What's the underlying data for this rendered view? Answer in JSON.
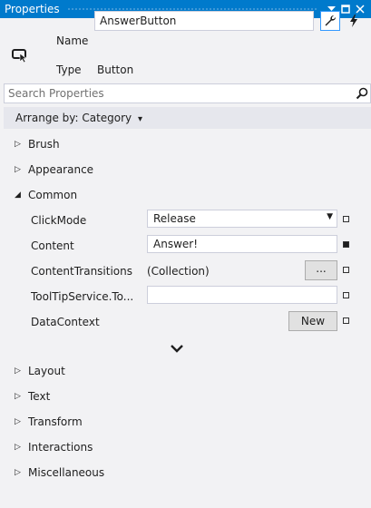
{
  "window": {
    "title": "Properties"
  },
  "header": {
    "name_label": "Name",
    "name_value": "AnswerButton",
    "type_label": "Type",
    "type_value": "Button"
  },
  "search": {
    "placeholder": "Search Properties"
  },
  "arrange": {
    "label": "Arrange by: Category",
    "arrow": "▾"
  },
  "categories_top": [
    {
      "label": "Brush",
      "expanded": false
    },
    {
      "label": "Appearance",
      "expanded": false
    },
    {
      "label": "Common",
      "expanded": true
    }
  ],
  "common": {
    "clickmode": {
      "label": "ClickMode",
      "value": "Release"
    },
    "content": {
      "label": "Content",
      "value": "Answer!"
    },
    "transitions": {
      "label": "ContentTransitions",
      "value": "(Collection)",
      "button": "..."
    },
    "tooltip": {
      "label": "ToolTipService.To...",
      "value": ""
    },
    "datacontext": {
      "label": "DataContext",
      "button": "New"
    }
  },
  "categories_bottom": [
    {
      "label": "Layout"
    },
    {
      "label": "Text"
    },
    {
      "label": "Transform"
    },
    {
      "label": "Interactions"
    },
    {
      "label": "Miscellaneous"
    }
  ],
  "glyphs": {
    "collapsed": "▷",
    "expanded": "◢"
  },
  "colors": {
    "titlebar": "#007acc",
    "panel": "#f2f2f4",
    "accent_border": "#3399ff"
  }
}
